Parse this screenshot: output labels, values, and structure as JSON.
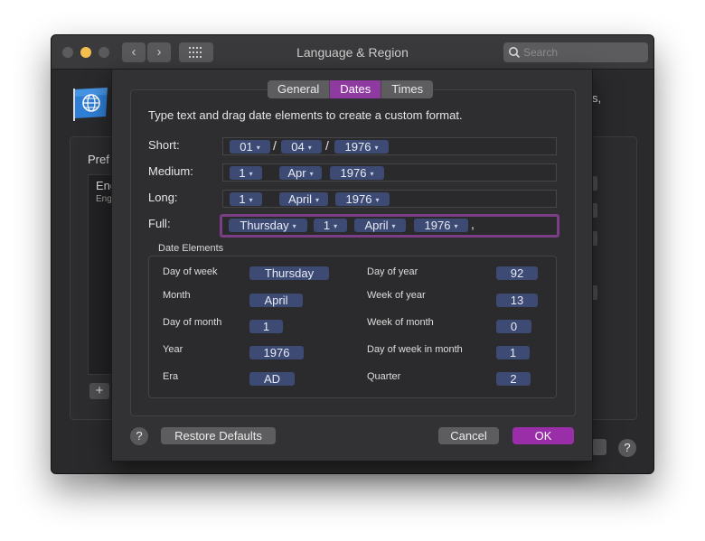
{
  "window": {
    "title": "Language & Region",
    "search_placeholder": "Search",
    "nav_back": "‹",
    "nav_forward": "›",
    "background_suffix": "s,",
    "background_pref_label": "Pref",
    "background_list_item": "Eng",
    "background_list_sub": "Eng",
    "add_label": "+",
    "help_label": "?"
  },
  "tabs": [
    {
      "label": "General",
      "active": false
    },
    {
      "label": "Dates",
      "active": true
    },
    {
      "label": "Times",
      "active": false
    }
  ],
  "instructions": "Type text and drag date elements to create a custom format.",
  "formats": {
    "short": {
      "label": "Short:",
      "tokens": [
        "01",
        "04",
        "1976"
      ],
      "separators": [
        "/",
        "/"
      ]
    },
    "medium": {
      "label": "Medium:",
      "tokens": [
        "1",
        "Apr",
        "1976"
      ]
    },
    "long": {
      "label": "Long:",
      "tokens": [
        "1",
        "April",
        "1976"
      ]
    },
    "full": {
      "label": "Full:",
      "tokens": [
        "Thursday",
        "1",
        "April",
        "1976"
      ],
      "trailing": ","
    }
  },
  "date_elements": {
    "title": "Date Elements",
    "left": [
      {
        "label": "Day of week",
        "value": "Thursday"
      },
      {
        "label": "Month",
        "value": "April"
      },
      {
        "label": "Day of month",
        "value": "1"
      },
      {
        "label": "Year",
        "value": "1976"
      },
      {
        "label": "Era",
        "value": "AD"
      }
    ],
    "right": [
      {
        "label": "Day of year",
        "value": "92"
      },
      {
        "label": "Week of year",
        "value": "13"
      },
      {
        "label": "Week of month",
        "value": "0"
      },
      {
        "label": "Day of week in month",
        "value": "1"
      },
      {
        "label": "Quarter",
        "value": "2"
      }
    ]
  },
  "buttons": {
    "help": "?",
    "restore_defaults": "Restore Defaults",
    "cancel": "Cancel",
    "ok": "OK"
  },
  "colors": {
    "accent": "#9a2ea9",
    "token_bg": "#3d4a73",
    "focus_ring": "#7b3d86",
    "traffic_yellow": "#f5bf4f"
  },
  "icons": {
    "chevron": "▾",
    "dropdown": "⌄"
  }
}
